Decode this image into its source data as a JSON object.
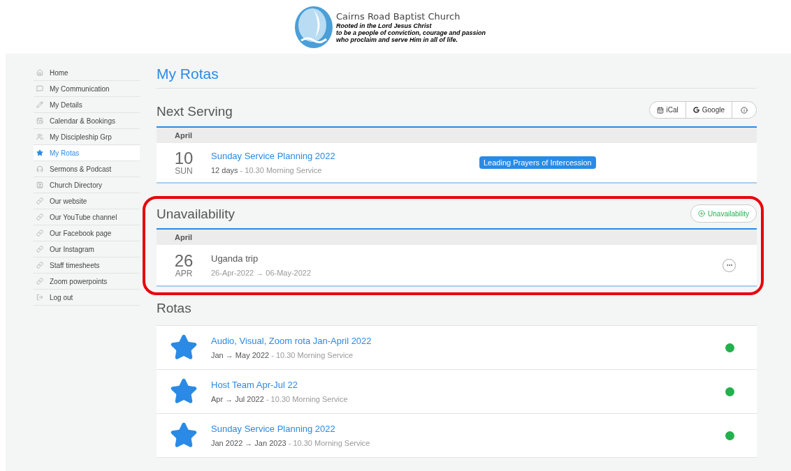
{
  "header": {
    "church_name": "Cairns Road Baptist Church",
    "tagline": [
      "Rooted in the Lord Jesus Christ",
      "to be a people of conviction, courage and passion",
      "who proclaim and serve Him in all of life."
    ]
  },
  "sidebar": {
    "items": [
      {
        "label": "Home",
        "selected": false
      },
      {
        "label": "My Communication",
        "selected": false
      },
      {
        "label": "My Details",
        "selected": false
      },
      {
        "label": "Calendar & Bookings",
        "selected": false
      },
      {
        "label": "My Discipleship Grp",
        "selected": false
      },
      {
        "label": "My Rotas",
        "selected": true
      },
      {
        "label": "Sermons & Podcast",
        "selected": false
      },
      {
        "label": "Church Directory",
        "selected": false
      },
      {
        "label": "Our website",
        "selected": false
      },
      {
        "label": "Our YouTube channel",
        "selected": false
      },
      {
        "label": "Our Facebook page",
        "selected": false
      },
      {
        "label": "Our Instagram",
        "selected": false
      },
      {
        "label": "Staff timesheets",
        "selected": false
      },
      {
        "label": "Zoom powerpoints",
        "selected": false
      },
      {
        "label": "Log out",
        "selected": false
      }
    ]
  },
  "page_title": "My Rotas",
  "next_serving": {
    "title": "Next Serving",
    "buttons": [
      "iCal",
      "Google"
    ],
    "month": "April",
    "events": [
      {
        "day": "10",
        "weekday": "SUN",
        "title": "Sunday Service Planning 2022",
        "when": "12 days",
        "detail": "- 10.30 Morning Service",
        "role": "Leading Prayers of Intercession"
      }
    ]
  },
  "unavailability": {
    "title": "Unavailability",
    "highlighted": true,
    "add_button": "Unavailability",
    "month": "April",
    "entries": [
      {
        "day": "26",
        "month_abbr": "APR",
        "title": "Uganda trip",
        "range": "26-Apr-2022 → 06-May-2022"
      }
    ]
  },
  "rotas": {
    "title": "Rotas",
    "items": [
      {
        "title": "Audio, Visual, Zoom rota Jan-April 2022",
        "period": "Jan → May 2022",
        "detail": "- 10.30 Morning Service",
        "color": "#22b14c"
      },
      {
        "title": "Host Team Apr-Jul 22",
        "period": "Apr → Jul 2022",
        "detail": "- 10.30 Morning Service",
        "color": "#22b14c"
      },
      {
        "title": "Sunday Service Planning 2022",
        "period": "Jan 2022 → Jan 2023",
        "detail": "- 10.30 Morning Service",
        "color": "#22b14c"
      }
    ]
  }
}
